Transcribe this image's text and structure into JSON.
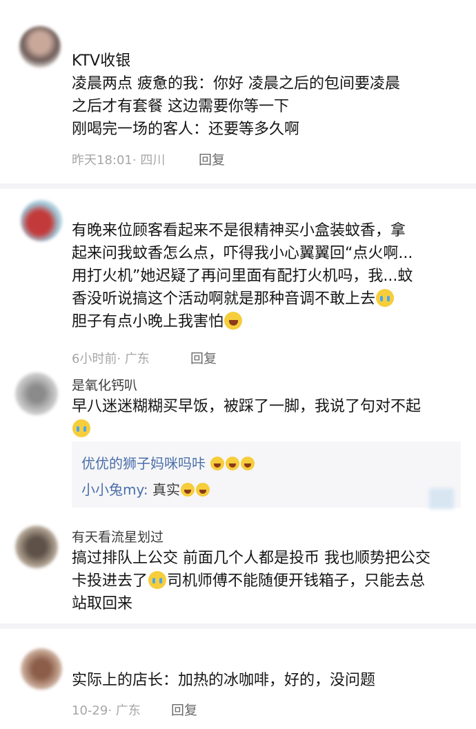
{
  "comments": [
    {
      "name": "",
      "lines": [
        "KTV收银",
        "凌晨两点 疲惫的我：你好 凌晨之后的包间要凌晨",
        "之后才有套餐 这边需要你等一下",
        "刚喝完一场的客人：还要等多久啊"
      ],
      "time": "昨天18:01",
      "location": "四川",
      "reply": "回复"
    },
    {
      "name": "",
      "lines": [
        "有晚来位顾客看起来不是很精神买小盒装蚊香，拿",
        "起来问我蚊香怎么点，吓得我小心翼翼回“点火啊...",
        "用打火机”她迟疑了再问里面有配打火机吗，我...蚊",
        "香没听说搞这个活动啊就是那种音调不敢上去",
        "胆子有点小晚上我害怕"
      ],
      "time": "6小时前",
      "location": "广东",
      "reply": "回复"
    },
    {
      "name": "是氧化钙叭",
      "lines": [
        "早八迷迷糊糊买早饭，被踩了一脚，我说了句对不起"
      ],
      "time": "",
      "location": "",
      "reply": "",
      "subreplies": [
        {
          "name": "优优的狮子妈咪吗咔",
          "text": ""
        },
        {
          "name": "小小兔my:",
          "text": " 真实"
        }
      ]
    },
    {
      "name": "有天看流星划过",
      "lines": [
        "搞过排队上公交 前面几个人都是投币 我也顺势把公交",
        "卡投进去了",
        "司机师傅不能随便开钱箱子，只能去总",
        "站取回来"
      ],
      "time": "",
      "location": "",
      "reply": ""
    },
    {
      "name": "",
      "lines": [
        "实际上的店长：加热的冰咖啡，好的，没问题"
      ],
      "time": "10-29",
      "location": "广东",
      "reply": "回复"
    }
  ],
  "colors": {
    "divider": "#f4f4f6",
    "meta": "#a6a6a6",
    "subreply_name": "#4a6ea8",
    "emoji": "#f6cd3b"
  },
  "icons": {
    "crying_emoji": "loudly-crying-face",
    "laughing_emoji": "face-with-tears-of-joy"
  }
}
